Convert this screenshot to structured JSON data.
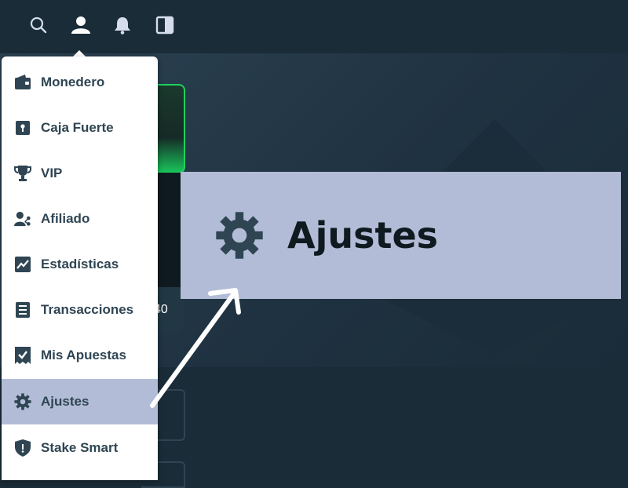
{
  "header": {
    "icons": [
      "search-icon",
      "user-icon",
      "bell-icon",
      "sidebar-toggle-icon"
    ]
  },
  "background": {
    "promo_value": "40"
  },
  "menu": {
    "items": [
      {
        "label": "Monedero",
        "icon": "wallet-icon"
      },
      {
        "label": "Caja Fuerte",
        "icon": "safe-icon"
      },
      {
        "label": "VIP",
        "icon": "trophy-icon"
      },
      {
        "label": "Afiliado",
        "icon": "affiliate-icon"
      },
      {
        "label": "Estadísticas",
        "icon": "stats-icon"
      },
      {
        "label": "Transacciones",
        "icon": "transactions-icon"
      },
      {
        "label": "Mis Apuestas",
        "icon": "bets-icon"
      },
      {
        "label": "Ajustes",
        "icon": "gear-icon",
        "active": true
      },
      {
        "label": "Stake Smart",
        "icon": "shield-icon"
      }
    ]
  },
  "callout": {
    "label": "Ajustes",
    "icon": "gear-icon"
  },
  "colors": {
    "page_bg": "#1a2c38",
    "menu_bg": "#ffffff",
    "menu_text": "#2f4553",
    "active_bg": "#b2bcd6",
    "promo_border": "#1fd15c"
  }
}
